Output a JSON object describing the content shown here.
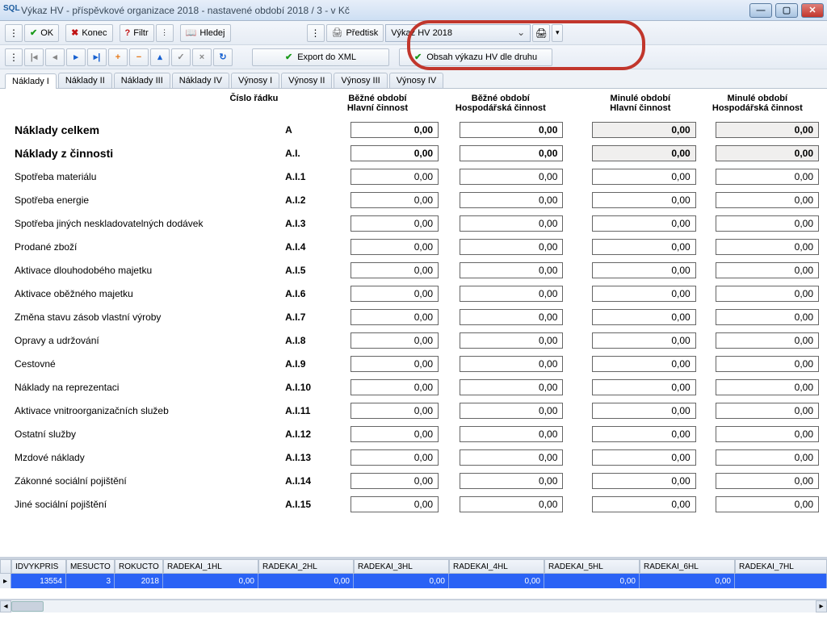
{
  "title": "Výkaz HV - příspěvkové organizace 2018 - nastavené období 2018 / 3 - v Kč",
  "toolbar": {
    "ok": "OK",
    "konec": "Konec",
    "filtr": "Filtr",
    "hledej": "Hledej",
    "predtisk": "Předtisk",
    "combo": "Výkaz HV 2018",
    "export": "Export do XML",
    "obsah": "Obsah výkazu HV dle druhu"
  },
  "tabs": [
    "Náklady I",
    "Náklady II",
    "Náklady III",
    "Náklady IV",
    "Výnosy I",
    "Výnosy II",
    "Výnosy III",
    "Výnosy IV"
  ],
  "cols": {
    "code": "Číslo řádku",
    "a1": "Běžné období",
    "a2": "Hlavní činnost",
    "b1": "Běžné období",
    "b2": "Hospodářská činnost",
    "c1": "Minulé období",
    "c2": "Hlavní činnost",
    "d1": "Minulé období",
    "d2": "Hospodářská činnost"
  },
  "v": "0,00",
  "rows": [
    {
      "label": "Náklady celkem",
      "code": "A",
      "bold": true,
      "gray": true
    },
    {
      "label": "Náklady z činnosti",
      "code": "A.I.",
      "bold": true,
      "gray": true
    },
    {
      "label": "Spotřeba materiálu",
      "code": "A.I.1"
    },
    {
      "label": "Spotřeba energie",
      "code": "A.I.2"
    },
    {
      "label": "Spotřeba jiných neskladovatelných dodávek",
      "code": "A.I.3"
    },
    {
      "label": "Prodané zboží",
      "code": "A.I.4"
    },
    {
      "label": "Aktivace dlouhodobého majetku",
      "code": "A.I.5"
    },
    {
      "label": "Aktivace oběžného majetku",
      "code": "A.I.6"
    },
    {
      "label": "Změna stavu zásob vlastní výroby",
      "code": "A.I.7"
    },
    {
      "label": "Opravy a udržování",
      "code": "A.I.8"
    },
    {
      "label": "Cestovné",
      "code": "A.I.9"
    },
    {
      "label": "Náklady na reprezentaci",
      "code": "A.I.10"
    },
    {
      "label": "Aktivace vnitroorganizačních služeb",
      "code": "A.I.11"
    },
    {
      "label": "Ostatní služby",
      "code": "A.I.12"
    },
    {
      "label": "Mzdové náklady",
      "code": "A.I.13"
    },
    {
      "label": "Zákonné sociální pojištění",
      "code": "A.I.14"
    },
    {
      "label": "Jiné sociální pojištění",
      "code": "A.I.15"
    }
  ],
  "grid": {
    "headers": [
      "IDVYKPRIS",
      "MESUCTO",
      "ROKUCTO",
      "RADEKAI_1HL",
      "RADEKAI_2HL",
      "RADEKAI_3HL",
      "RADEKAI_4HL",
      "RADEKAI_5HL",
      "RADEKAI_6HL",
      "RADEKAI_7HL"
    ],
    "row": [
      "13554",
      "3",
      "2018",
      "0,00",
      "0,00",
      "0,00",
      "0,00",
      "0,00",
      "0,00"
    ]
  }
}
